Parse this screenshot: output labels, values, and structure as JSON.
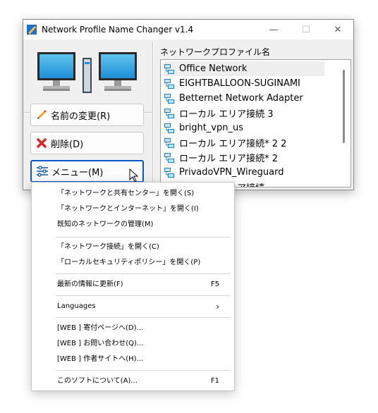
{
  "window": {
    "title": "Network Profile Name Changer v1.4",
    "controls": {
      "minimize": "—",
      "maximize": "☐",
      "close": "✕"
    }
  },
  "left": {
    "rename_label": "名前の変更(R)",
    "delete_label": "削除(D)",
    "menu_label": "メニュー(M)"
  },
  "list": {
    "header": "ネットワークプロファイル名",
    "items": [
      "Office Network",
      "EIGHTBALLOON-SUGINAMI",
      "Betternet Network Adapter",
      "ローカル エリア接続 3",
      "bright_vpn_us",
      "ローカル エリア接続* 2 2",
      "ローカル エリア接続* 2",
      "PrivadoVPN_Wireguard",
      "ローカル エリア接続"
    ],
    "selected_index": 0
  },
  "menu": {
    "items": [
      {
        "label": "「ネットワークと共有センター」を開く(S)",
        "shortcut": ""
      },
      {
        "label": "「ネットワークとインターネット」を開く(I)",
        "shortcut": ""
      },
      {
        "label": "既知のネットワークの管理(M)",
        "shortcut": ""
      },
      {
        "label": "「ネットワーク接続」を開く(C)",
        "shortcut": ""
      },
      {
        "label": "「ローカルセキュリティポリシー」を開く(P)",
        "shortcut": ""
      },
      {
        "label": "最新の情報に更新(F)",
        "shortcut": "F5"
      },
      {
        "label": "Languages",
        "shortcut": ""
      },
      {
        "label": "[WEB ] 寄付ページへ(D)...",
        "shortcut": ""
      },
      {
        "label": "[WEB ] お問い合わせ(Q)...",
        "shortcut": ""
      },
      {
        "label": "[WEB ] 作者サイトへ(H)...",
        "shortcut": ""
      },
      {
        "label": "このソフトについて(A)...",
        "shortcut": "F1"
      }
    ],
    "submenu_arrow": "›"
  },
  "colors": {
    "accent": "#0a57c8",
    "window_bg": "#f0f0f0",
    "selection": "#eeeeee",
    "network_icon": "#1a7fc9"
  }
}
